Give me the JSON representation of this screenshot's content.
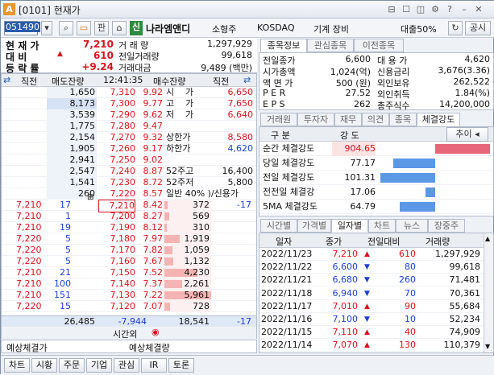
{
  "window": {
    "title": "[0101] 현재가",
    "logo": "A"
  },
  "toolbar": {
    "code": "051490",
    "chart_btn": "판",
    "badge": "신",
    "stock_name": "나라엠앤디",
    "size": "소형주",
    "market": "KOSDAQ",
    "sector": "기계 장비",
    "loan": "대출50%",
    "share": "공시"
  },
  "summary": {
    "labels": [
      "현 재 가",
      "대    비",
      "등 락 률"
    ],
    "price": "7,210",
    "diff": "610",
    "rate": "+9.24",
    "vol_label": "거 래 량",
    "vol": "1,297,929",
    "prev_vol_label": "전일거래량",
    "prev_vol": "99,618",
    "amt_label": "거래대금",
    "amt": "9,489 (백만)"
  },
  "info": {
    "tabs": [
      "종목정보",
      "관심종목",
      "이전종목"
    ],
    "rows": [
      [
        "전일종가",
        "6,600",
        "대 용 가",
        "4,620"
      ],
      [
        "시가총액",
        "1,024(억)",
        "신용금리",
        "3,676(3.36)"
      ],
      [
        "액 면 가",
        "500 (원)",
        "외인보유",
        "262,522"
      ],
      [
        "P E R",
        "27.52",
        "외인취득",
        "1.84(%)"
      ],
      [
        "E P S",
        "262",
        "총주식수",
        "14,200,000"
      ]
    ]
  },
  "orderbook": {
    "header": [
      "직전",
      "매도잔량",
      "12:41:35",
      "매수잔량",
      "직전"
    ],
    "asks": [
      [
        "1,650",
        "7,310",
        "9.92"
      ],
      [
        "8,173",
        "7,300",
        "9.77"
      ],
      [
        "3,539",
        "7,290",
        "9.62"
      ],
      [
        "1,775",
        "7,280",
        "9.47"
      ],
      [
        "2,154",
        "7,270",
        "9.32"
      ],
      [
        "1,905",
        "7,260",
        "9.17"
      ],
      [
        "2,941",
        "7,250",
        "9.02"
      ],
      [
        "2,547",
        "7,240",
        "8.87"
      ],
      [
        "1,541",
        "7,230",
        "8.72"
      ],
      [
        "260",
        "7,220",
        "8.57"
      ]
    ],
    "ask_info": [
      [
        "시",
        "가",
        "6,650"
      ],
      [
        "고",
        "가",
        "7,650"
      ],
      [
        "저",
        "가",
        "6,640"
      ],
      [
        "",
        "",
        ""
      ],
      [
        "상한가",
        "",
        "8,580"
      ],
      [
        "하한가",
        "",
        "4,620"
      ],
      [
        "",
        "",
        ""
      ],
      [
        "52주고",
        "",
        "16,400"
      ],
      [
        "52주저",
        "",
        "5,800"
      ],
      [
        "일반 40% )/신용가",
        "",
        ""
      ]
    ],
    "bids": [
      [
        "7,210",
        "8.42",
        "372"
      ],
      [
        "7,200",
        "8.27",
        "569"
      ],
      [
        "7,190",
        "8.12",
        "310"
      ],
      [
        "7,180",
        "7.97",
        "1,919"
      ],
      [
        "7,170",
        "7.82",
        "1,059"
      ],
      [
        "7,160",
        "7.67",
        "1,132"
      ],
      [
        "7,150",
        "7.52",
        "4,230"
      ],
      [
        "7,140",
        "7.37",
        "2,261"
      ],
      [
        "7,130",
        "7.22",
        "5,961"
      ],
      [
        "7,120",
        "7.07",
        "728"
      ]
    ],
    "ticks": [
      [
        "7,210",
        "17"
      ],
      [
        "7,210",
        "1"
      ],
      [
        "7,210",
        "19"
      ],
      [
        "7,220",
        "5"
      ],
      [
        "7,220",
        "5"
      ],
      [
        "7,220",
        "5"
      ],
      [
        "7,210",
        "21"
      ],
      [
        "7,210",
        "100"
      ],
      [
        "7,210",
        "151"
      ],
      [
        "7,220",
        "15"
      ]
    ],
    "first_bid_change": "-17",
    "total_ask": "26,485",
    "total_diff": "-7,944",
    "total_bid": "18,541",
    "total_change": "-17",
    "after": "시간외"
  },
  "expect": {
    "left": "예상체결가",
    "right": "예상체결량"
  },
  "mid_tabs": [
    "거래원",
    "투자자",
    "재무",
    "의견",
    "종목",
    "체결강도"
  ],
  "strength": {
    "head": [
      "구  분",
      "강  도"
    ],
    "more": "추이",
    "rows": [
      [
        "순간 체결강도",
        "904.65"
      ],
      [
        "당일 체결강도",
        "77.17"
      ],
      [
        "전일 체결강도",
        "101.31"
      ],
      [
        "전전일 체결강",
        "17.06"
      ],
      [
        "5MA 체결강도",
        "64.79"
      ]
    ],
    "values": [
      904.65,
      77.17,
      101.31,
      17.06,
      64.79
    ]
  },
  "daily_tabs": [
    "시간별",
    "가격별",
    "일자별",
    "차트",
    "뉴스",
    "장중주"
  ],
  "daily": {
    "head": [
      "일자",
      "종가",
      "전일대비",
      "거래량"
    ],
    "rows": [
      [
        "2022/11/23",
        "7,210",
        "610",
        "1,297,929",
        "up"
      ],
      [
        "2022/11/22",
        "6,600",
        "80",
        "99,618",
        "down"
      ],
      [
        "2022/11/21",
        "6,680",
        "260",
        "71,481",
        "down"
      ],
      [
        "2022/11/18",
        "6,940",
        "70",
        "70,361",
        "down"
      ],
      [
        "2022/11/17",
        "7,010",
        "90",
        "55,684",
        "up"
      ],
      [
        "2022/11/16",
        "7,100",
        "10",
        "52,234",
        "down"
      ],
      [
        "2022/11/15",
        "7,110",
        "40",
        "74,909",
        "up"
      ],
      [
        "2022/11/14",
        "7,070",
        "130",
        "110,379",
        "up"
      ]
    ]
  },
  "bottom": [
    "차트",
    "시황",
    "주문",
    "기업",
    "관심",
    "IR",
    "토론"
  ],
  "colors": {
    "up": "#d8141e",
    "down": "#1b3fd1",
    "ask_bar": "#a8c4ea",
    "bid_bar": "#f4b4b4"
  }
}
